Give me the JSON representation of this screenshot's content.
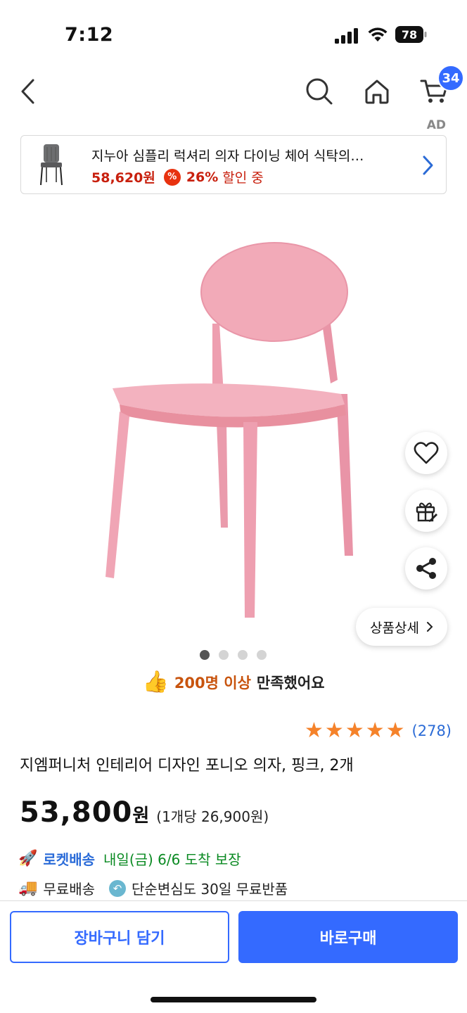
{
  "status_bar": {
    "time": "7:12",
    "battery": "78"
  },
  "nav": {
    "cart_count": "34"
  },
  "ad": {
    "tag": "AD",
    "title": "지누아 심플리 럭셔리 의자 다이닝 체어 식탁의…",
    "price": "58,620원",
    "discount_icon": "%",
    "discount_pct": "26%",
    "discount_text": "할인 중"
  },
  "hero": {
    "detail_label": "상품상세",
    "image_count": 4,
    "active_image": 1
  },
  "satisfaction": {
    "highlight": "200명 이상",
    "text": "만족했어요"
  },
  "rating": {
    "stars": 5,
    "review_count": "(278)"
  },
  "product": {
    "title": "지엠퍼니처 인테리어 디자인 포니오 의자, 핑크, 2개",
    "price": "53,800",
    "price_unit": "원",
    "unit_price": "(1개당 26,900원)"
  },
  "delivery": {
    "rocket_brand": "로켓배송",
    "rocket_text": "내일(금) 6/6 도착 보장",
    "free_shipping": "무료배송",
    "return_policy": "단순변심도 30일 무료반품"
  },
  "actions": {
    "add_to_cart": "장바구니 담기",
    "buy_now": "바로구매"
  },
  "colors": {
    "accent": "#346aff",
    "price_red": "#c8200e",
    "star": "#f5822a",
    "rocket_green": "#0a8a22",
    "chair_pink": "#f2aab8"
  }
}
